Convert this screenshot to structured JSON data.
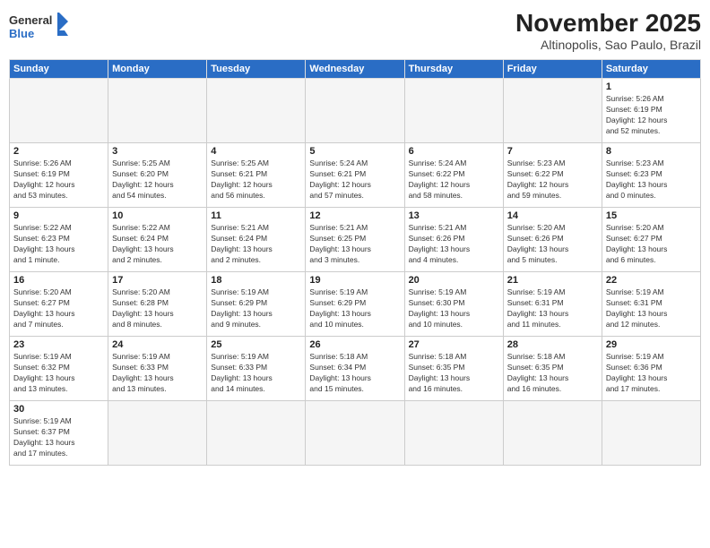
{
  "logo": {
    "text_general": "General",
    "text_blue": "Blue"
  },
  "title": "November 2025",
  "subtitle": "Altinopolis, Sao Paulo, Brazil",
  "weekdays": [
    "Sunday",
    "Monday",
    "Tuesday",
    "Wednesday",
    "Thursday",
    "Friday",
    "Saturday"
  ],
  "days": [
    {
      "num": "",
      "info": ""
    },
    {
      "num": "",
      "info": ""
    },
    {
      "num": "",
      "info": ""
    },
    {
      "num": "",
      "info": ""
    },
    {
      "num": "",
      "info": ""
    },
    {
      "num": "",
      "info": ""
    },
    {
      "num": "1",
      "info": "Sunrise: 5:26 AM\nSunset: 6:19 PM\nDaylight: 12 hours\nand 52 minutes."
    },
    {
      "num": "2",
      "info": "Sunrise: 5:26 AM\nSunset: 6:19 PM\nDaylight: 12 hours\nand 53 minutes."
    },
    {
      "num": "3",
      "info": "Sunrise: 5:25 AM\nSunset: 6:20 PM\nDaylight: 12 hours\nand 54 minutes."
    },
    {
      "num": "4",
      "info": "Sunrise: 5:25 AM\nSunset: 6:21 PM\nDaylight: 12 hours\nand 56 minutes."
    },
    {
      "num": "5",
      "info": "Sunrise: 5:24 AM\nSunset: 6:21 PM\nDaylight: 12 hours\nand 57 minutes."
    },
    {
      "num": "6",
      "info": "Sunrise: 5:24 AM\nSunset: 6:22 PM\nDaylight: 12 hours\nand 58 minutes."
    },
    {
      "num": "7",
      "info": "Sunrise: 5:23 AM\nSunset: 6:22 PM\nDaylight: 12 hours\nand 59 minutes."
    },
    {
      "num": "8",
      "info": "Sunrise: 5:23 AM\nSunset: 6:23 PM\nDaylight: 13 hours\nand 0 minutes."
    },
    {
      "num": "9",
      "info": "Sunrise: 5:22 AM\nSunset: 6:23 PM\nDaylight: 13 hours\nand 1 minute."
    },
    {
      "num": "10",
      "info": "Sunrise: 5:22 AM\nSunset: 6:24 PM\nDaylight: 13 hours\nand 2 minutes."
    },
    {
      "num": "11",
      "info": "Sunrise: 5:21 AM\nSunset: 6:24 PM\nDaylight: 13 hours\nand 2 minutes."
    },
    {
      "num": "12",
      "info": "Sunrise: 5:21 AM\nSunset: 6:25 PM\nDaylight: 13 hours\nand 3 minutes."
    },
    {
      "num": "13",
      "info": "Sunrise: 5:21 AM\nSunset: 6:26 PM\nDaylight: 13 hours\nand 4 minutes."
    },
    {
      "num": "14",
      "info": "Sunrise: 5:20 AM\nSunset: 6:26 PM\nDaylight: 13 hours\nand 5 minutes."
    },
    {
      "num": "15",
      "info": "Sunrise: 5:20 AM\nSunset: 6:27 PM\nDaylight: 13 hours\nand 6 minutes."
    },
    {
      "num": "16",
      "info": "Sunrise: 5:20 AM\nSunset: 6:27 PM\nDaylight: 13 hours\nand 7 minutes."
    },
    {
      "num": "17",
      "info": "Sunrise: 5:20 AM\nSunset: 6:28 PM\nDaylight: 13 hours\nand 8 minutes."
    },
    {
      "num": "18",
      "info": "Sunrise: 5:19 AM\nSunset: 6:29 PM\nDaylight: 13 hours\nand 9 minutes."
    },
    {
      "num": "19",
      "info": "Sunrise: 5:19 AM\nSunset: 6:29 PM\nDaylight: 13 hours\nand 10 minutes."
    },
    {
      "num": "20",
      "info": "Sunrise: 5:19 AM\nSunset: 6:30 PM\nDaylight: 13 hours\nand 10 minutes."
    },
    {
      "num": "21",
      "info": "Sunrise: 5:19 AM\nSunset: 6:31 PM\nDaylight: 13 hours\nand 11 minutes."
    },
    {
      "num": "22",
      "info": "Sunrise: 5:19 AM\nSunset: 6:31 PM\nDaylight: 13 hours\nand 12 minutes."
    },
    {
      "num": "23",
      "info": "Sunrise: 5:19 AM\nSunset: 6:32 PM\nDaylight: 13 hours\nand 13 minutes."
    },
    {
      "num": "24",
      "info": "Sunrise: 5:19 AM\nSunset: 6:33 PM\nDaylight: 13 hours\nand 13 minutes."
    },
    {
      "num": "25",
      "info": "Sunrise: 5:19 AM\nSunset: 6:33 PM\nDaylight: 13 hours\nand 14 minutes."
    },
    {
      "num": "26",
      "info": "Sunrise: 5:18 AM\nSunset: 6:34 PM\nDaylight: 13 hours\nand 15 minutes."
    },
    {
      "num": "27",
      "info": "Sunrise: 5:18 AM\nSunset: 6:35 PM\nDaylight: 13 hours\nand 16 minutes."
    },
    {
      "num": "28",
      "info": "Sunrise: 5:18 AM\nSunset: 6:35 PM\nDaylight: 13 hours\nand 16 minutes."
    },
    {
      "num": "29",
      "info": "Sunrise: 5:19 AM\nSunset: 6:36 PM\nDaylight: 13 hours\nand 17 minutes."
    },
    {
      "num": "30",
      "info": "Sunrise: 5:19 AM\nSunset: 6:37 PM\nDaylight: 13 hours\nand 17 minutes."
    },
    {
      "num": "",
      "info": ""
    },
    {
      "num": "",
      "info": ""
    },
    {
      "num": "",
      "info": ""
    },
    {
      "num": "",
      "info": ""
    },
    {
      "num": "",
      "info": ""
    },
    {
      "num": "",
      "info": ""
    }
  ]
}
